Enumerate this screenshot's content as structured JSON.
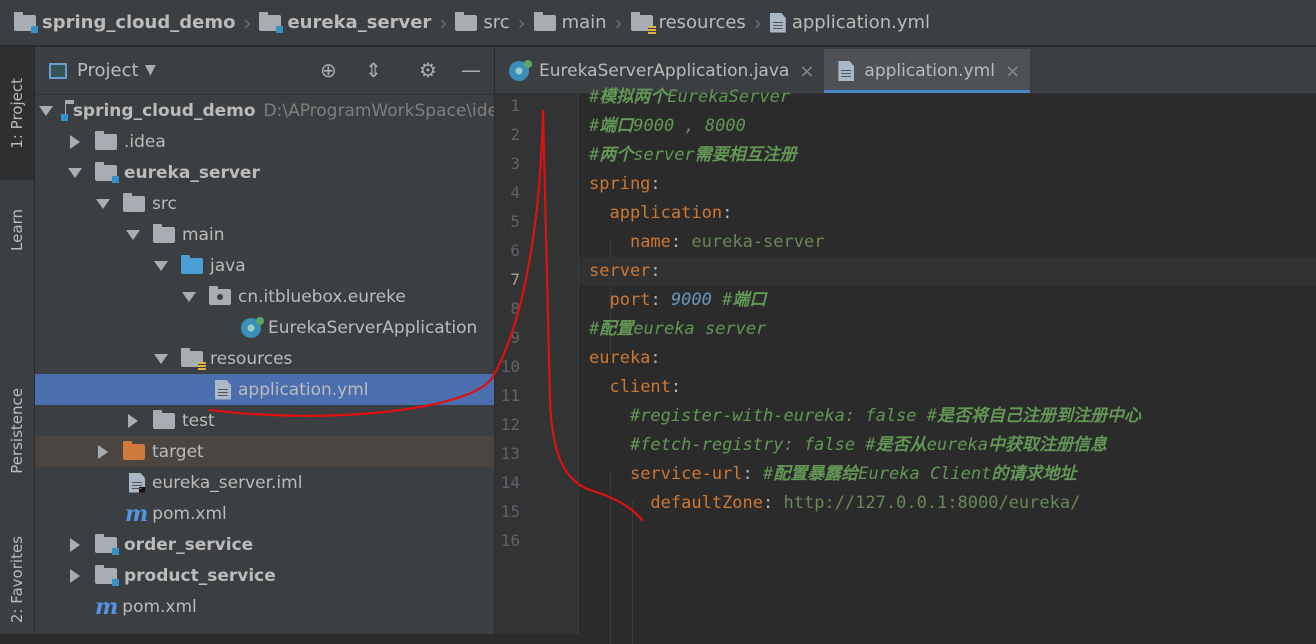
{
  "breadcrumb": [
    "spring_cloud_demo",
    "eureka_server",
    "src",
    "main",
    "resources",
    "application.yml"
  ],
  "side_rail": {
    "top_tabs": [
      "1: Project",
      "Learn"
    ],
    "bottom_tabs": [
      "Persistence",
      "2: Favorites"
    ]
  },
  "project_panel": {
    "view_label": "Project"
  },
  "tree": [
    {
      "label": "spring_cloud_demo",
      "path": "D:\\AProgramWorkSpace\\ide",
      "bold": true
    },
    {
      "label": ".idea"
    },
    {
      "label": "eureka_server",
      "bold": true
    },
    {
      "label": "src"
    },
    {
      "label": "main"
    },
    {
      "label": "java"
    },
    {
      "label": "cn.itbluebox.eureke"
    },
    {
      "label": "EurekaServerApplication"
    },
    {
      "label": "resources"
    },
    {
      "label": "application.yml",
      "selected": true
    },
    {
      "label": "test"
    },
    {
      "label": "target"
    },
    {
      "label": "eureka_server.iml"
    },
    {
      "label": "pom.xml"
    },
    {
      "label": "order_service",
      "bold": true
    },
    {
      "label": "product_service",
      "bold": true
    },
    {
      "label": "pom.xml"
    }
  ],
  "tabs": [
    {
      "label": "EurekaServerApplication.java",
      "active": false
    },
    {
      "label": "application.yml",
      "active": true
    }
  ],
  "code_lines": [
    "#模拟两个EurekaServer",
    "#端口9000 , 8000",
    "#两个server需要相互注册",
    "spring:",
    "  application:",
    "    name: eureka-server",
    "server:",
    "  port: 9000 #端口",
    "#配置eureka server",
    "eureka:",
    "  client:",
    "    #register-with-eureka: false #是否将自己注册到注册中心",
    "    #fetch-registry: false #是否从eureka中获取注册信息",
    "    service-url: #配置暴露给Eureka Client的请求地址",
    "      defaultZone: http://127.0.0.1:8000/eureka/",
    ""
  ],
  "current_line": 7,
  "colors": {
    "comment": "#629755",
    "key": "#cc7832",
    "string": "#6a8759",
    "number": "#6897bb",
    "selection": "#4b6eaf",
    "annotation": "#e01010"
  }
}
